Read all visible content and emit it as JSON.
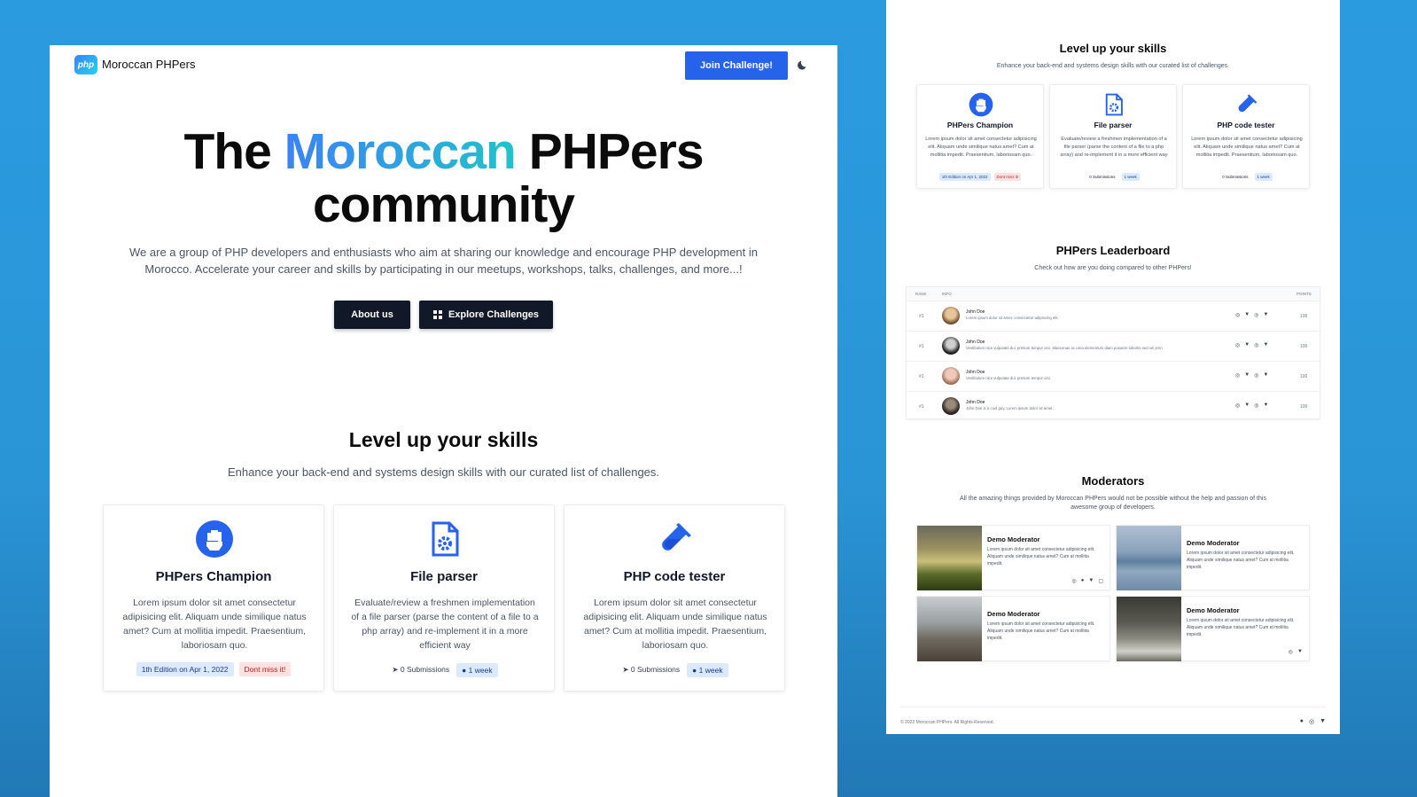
{
  "colors": {
    "accent": "#2563eb",
    "dark": "#111827",
    "gradient_start": "#3b82f6",
    "gradient_end": "#22c3c9"
  },
  "nav": {
    "logo_icon_text": "php",
    "brand": "Moroccan PHPers",
    "join_label": "Join Challenge!",
    "theme_icon": "moon-icon"
  },
  "hero": {
    "title_pre": "The",
    "title_highlight": "Moroccan",
    "title_post": "PHPers",
    "title_line2": "community",
    "description": "We are a group of PHP developers and enthusiasts who aim at sharing our knowledge and encourage PHP development in Morocco. Accelerate your career and skills by participating in our meetups, workshops, talks, challenges, and more...!",
    "about_label": "About us",
    "explore_label": "Explore Challenges",
    "explore_icon": "grid-icon"
  },
  "skills": {
    "title": "Level up your skills",
    "subtitle": "Enhance your back-end and systems design skills with our curated list of challenges.",
    "cards": [
      {
        "icon": "fist-icon",
        "title": "PHPers Champion",
        "description": "Lorem ipsum dolor sit amet consectetur adipisicing elit. Aliquam unde similique natus amet? Cum at mollitia impedit. Praesentium, laboriosam quo.",
        "tag1": "1th Edition on Apr 1, 2022",
        "tag2": "Dont miss it!"
      },
      {
        "icon": "file-gear-icon",
        "title": "File parser",
        "description": "Evaluate/review a freshmen implementation of a file parser (parse the content of a file to a php array) and re-implement it in a more efficient way",
        "tag1": "0 Submissions",
        "tag2": "1 week"
      },
      {
        "icon": "vial-icon",
        "title": "PHP code tester",
        "description": "Lorem ipsum dolor sit amet consectetur adipisicing elit. Aliquam unde similique natus amet? Cum at mollitia impedit. Praesentium, laboriosam quo.",
        "tag1": "0 Submissions",
        "tag2": "1 week"
      }
    ],
    "cards_small_tags": [
      {
        "tag1": "1th Edition on Apr 1, 2022",
        "tag2": "Dont miss it!"
      },
      {
        "tag1": "0 Submissions",
        "tag2": "1 week"
      },
      {
        "tag1": "0 Submissions",
        "tag2": "1 week"
      }
    ]
  },
  "leaderboard": {
    "title": "PHPers Leaderboard",
    "subtitle": "Check out how are you doing compared to other PHPers!",
    "headers": {
      "rank": "RANK",
      "info": "INFO",
      "points": "POINTS"
    },
    "rows": [
      {
        "rank": "#1",
        "name": "John Doe",
        "bio": "Lorem ipsum dolor sit amet, consectetur adipiscing elit.",
        "points": "100"
      },
      {
        "rank": "#1",
        "name": "John Doe",
        "bio": "Vestibulum nice vulputate dui, pretium tempor orci. Maecenas ac urna elementum diam posuere lobortis sed vel jenn.",
        "points": "100"
      },
      {
        "rank": "#1",
        "name": "John Doe",
        "bio": "Vestibulum nice vulputate dui, pretium tempor orci.",
        "points": "100"
      },
      {
        "rank": "#1",
        "name": "John Doe",
        "bio": "John Doe is a cool guy. Lorem ipsum dolor sit amet.",
        "points": "100"
      }
    ]
  },
  "moderators": {
    "title": "Moderators",
    "subtitle": "All the amazing things provided by Moroccan PHPers would not be possible without the help and passion of this awesome group of developers.",
    "items": [
      {
        "name": "Demo Moderator",
        "description": "Lorem ipsum dolor sit amet consectetur adipisicing elit. Aliquam unde similique natus amet? Cum at mollitia impedit."
      },
      {
        "name": "Demo Moderator",
        "description": "Lorem ipsum dolor sit amet consectetur adipisicing elit. Aliquam unde similique natus amet? Cum at mollitia impedit."
      },
      {
        "name": "Demo Moderator",
        "description": "Lorem ipsum dolor sit amet consectetur adipisicing elit. Aliquam unde similique natus amet? Cum at mollitia impedit."
      },
      {
        "name": "Demo Moderator",
        "description": "Lorem ipsum dolor sit amet consectetur adipisicing elit. Aliquam unde similique natus amet? Cum at mollitia impedit."
      }
    ]
  },
  "footer": {
    "copyright": "© 2022 Moroccan PHPers. All Rights Reserved."
  }
}
